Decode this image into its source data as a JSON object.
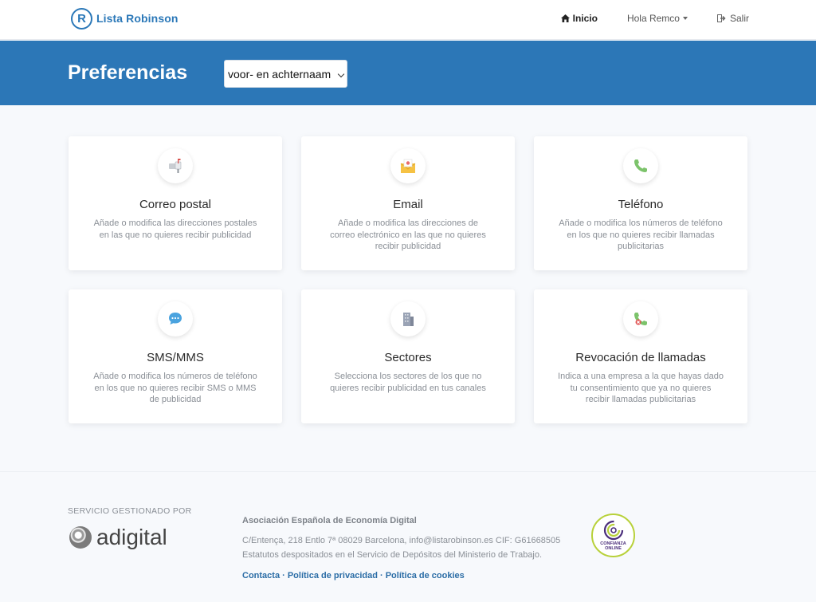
{
  "brand": {
    "mark": "R",
    "name": "Lista Robinson"
  },
  "nav": {
    "home": "Inicio",
    "user": "Hola Remco",
    "logout": "Salir"
  },
  "hero": {
    "title": "Preferencias",
    "select_value": "voor- en achternaam"
  },
  "cards": [
    {
      "title": "Correo postal",
      "desc": "Añade o modifica las direcciones postales en las que no quieres recibir publicidad",
      "icon": "mailbox-icon"
    },
    {
      "title": "Email",
      "desc": "Añade o modifica las direcciones de correo electrónico en las que no quieres recibir publicidad",
      "icon": "email-envelope-icon"
    },
    {
      "title": "Teléfono",
      "desc": "Añade o modifica los números de teléfono en los que no quieres recibir llamadas publicitarias",
      "icon": "phone-icon"
    },
    {
      "title": "SMS/MMS",
      "desc": "Añade o modifica los números de teléfono en los que no quieres recibir SMS o MMS de publicidad",
      "icon": "chat-bubble-icon"
    },
    {
      "title": "Sectores",
      "desc": "Selecciona los sectores de los que no quieres recibir publicidad en tus canales",
      "icon": "building-icon"
    },
    {
      "title": "Revocación de llamadas",
      "desc": "Indica a una empresa a la que hayas dado tu consentimiento que ya no quieres recibir llamadas publicitarias",
      "icon": "phone-revoke-icon"
    }
  ],
  "footer": {
    "managed_by": "SERVICIO GESTIONADO POR",
    "adigital": "adigital",
    "assoc_title": "Asociación Española de Economía Digital",
    "line1": "C/Entença, 218 Entlo 7ª 08029 Barcelona, info@listarobinson.es CIF: G61668505",
    "line2": "Estatutos despositados en el Servicio de Depósitos del Ministerio de Trabajo.",
    "links": [
      "Contacta",
      "Política de privacidad",
      "Política de cookies"
    ],
    "separator": " · ",
    "seal_text": "CONFIANZA ONLINE"
  },
  "colors": {
    "primary": "#2c77b7",
    "link": "#2b6da6",
    "seal_green": "#b8d13a",
    "seal_purple": "#4a2d7a"
  }
}
